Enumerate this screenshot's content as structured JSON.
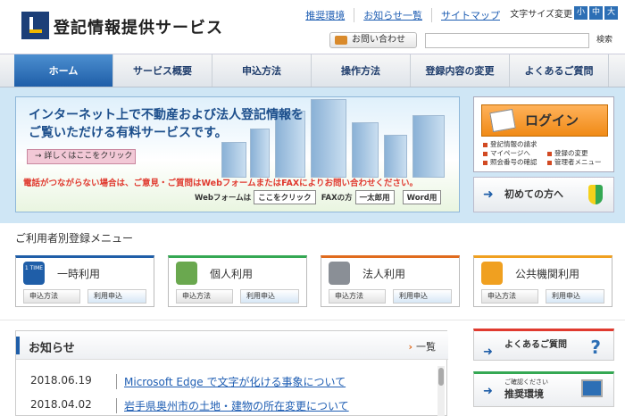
{
  "header": {
    "site_title": "登記情報提供サービス",
    "links": [
      "推奨環境",
      "お知らせ一覧",
      "サイトマップ"
    ],
    "font_size_label": "文字サイズ変更",
    "font_sizes": [
      "小",
      "中",
      "大"
    ],
    "contact_label": "お問い合わせ",
    "search_placeholder": "",
    "search_button": "検索"
  },
  "nav": {
    "items": [
      "ホーム",
      "サービス概要",
      "申込方法",
      "操作方法",
      "登録内容の変更",
      "よくあるご質問"
    ]
  },
  "hero": {
    "line1": "インターネット上で不動産および法人登記情報を",
    "line2": "ご覧いただける有料サービスです。",
    "detail_button": "→ 詳しくはここをクリック",
    "notice": "電話がつながらない場合は、ご意見・ご質問はWebフォームまたはFAXによりお問い合わせください。",
    "web_form_label": "Webフォームは",
    "web_form_button": "ここをクリック",
    "fax_label": "FAXの方",
    "fax_button1": "一太郎用",
    "fax_button2": "Word用"
  },
  "login": {
    "button": "ログイン",
    "links": [
      "登記情報の請求",
      "登録の変更",
      "マイページへ",
      "管理者メニュー",
      "照会番号の確認"
    ],
    "first_time": "初めての方へ"
  },
  "users": {
    "section_title": "ご利用者別登録メニュー",
    "cards": [
      {
        "label": "一時利用",
        "icon_text": "1 TIME",
        "btn1": "申込方法",
        "btn2": "利用申込",
        "color": "#1f5ea8"
      },
      {
        "label": "個人利用",
        "btn1": "申込方法",
        "btn2": "利用申込",
        "color": "#34a853"
      },
      {
        "label": "法人利用",
        "btn1": "申込方法",
        "btn2": "利用申込",
        "color": "#e06b1d"
      },
      {
        "label": "公共機関利用",
        "btn1": "申込方法",
        "btn2": "利用申込",
        "color": "#f0a020"
      }
    ]
  },
  "news": {
    "title": "お知らせ",
    "more": "一覧",
    "items": [
      {
        "date": "2018.06.19",
        "title": "Microsoft Edge で文字が化ける事象について"
      },
      {
        "date": "2018.04.02",
        "title": "岩手県奥州市の土地・建物の所在変更について"
      }
    ]
  },
  "side": {
    "faq": "よくあるご質問",
    "env_small": "ご確認ください",
    "env": "推奨環境"
  }
}
